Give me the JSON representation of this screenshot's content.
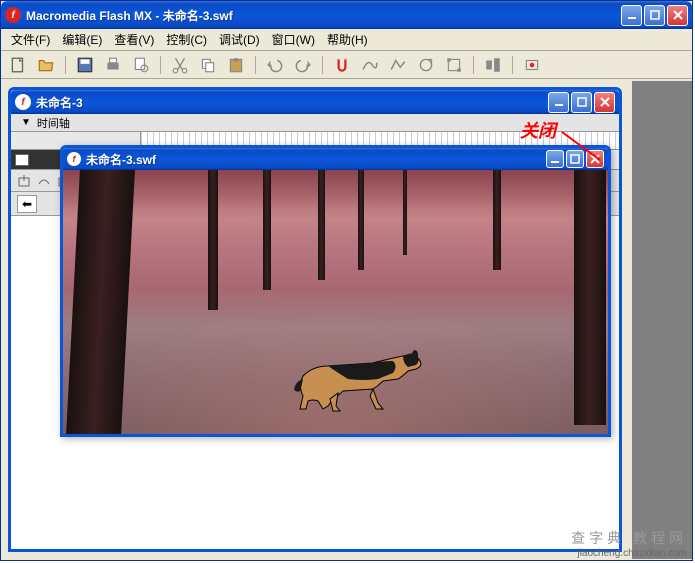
{
  "main_window": {
    "title": "Macromedia Flash MX - 未命名-3.swf"
  },
  "menubar": {
    "items": [
      "文件(F)",
      "编辑(E)",
      "查看(V)",
      "控制(C)",
      "调试(D)",
      "窗口(W)",
      "帮助(H)"
    ]
  },
  "toolbar": {
    "icons": [
      "new-file",
      "open-file",
      "save",
      "print",
      "print-preview",
      "cut",
      "copy",
      "paste",
      "undo",
      "redo",
      "snap",
      "smooth",
      "straighten",
      "rotate",
      "scale",
      "align",
      "debug"
    ]
  },
  "doc_window": {
    "title": "未命名-3",
    "timeline_label": "时间轴"
  },
  "swf_window": {
    "title": "未命名-3.swf"
  },
  "annotation": {
    "text": "关闭"
  },
  "watermark": {
    "line1": "查字典 教程网",
    "line2": "jiaocheng.chazidian.com"
  }
}
